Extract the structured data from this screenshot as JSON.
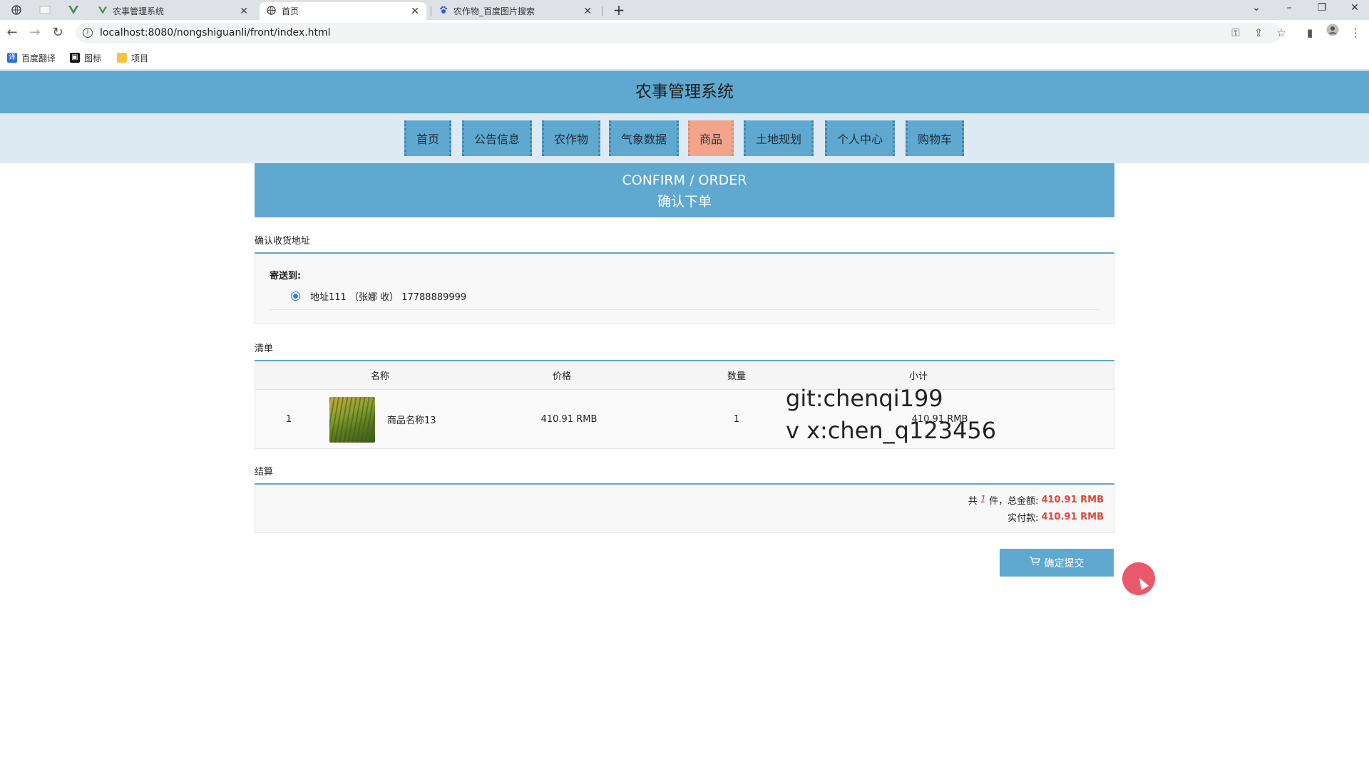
{
  "browser": {
    "tabs": [
      {
        "title": "农事管理系统",
        "active": false
      },
      {
        "title": "首页",
        "active": true
      },
      {
        "title": "农作物_百度图片搜索",
        "active": false
      }
    ],
    "url": "localhost:8080/nongshiguanli/front/index.html",
    "bookmarks": [
      "百度翻译",
      "图标",
      "项目"
    ]
  },
  "site": {
    "title": "农事管理系统",
    "nav": [
      "首页",
      "公告信息",
      "农作物",
      "气象数据",
      "商品",
      "土地规划",
      "个人中心",
      "购物车"
    ],
    "active_nav": "商品"
  },
  "banner": {
    "en": "CONFIRM / ORDER",
    "zh": "确认下单"
  },
  "address": {
    "section_title": "确认收货地址",
    "ship_label": "寄送到:",
    "entry": "地址111 （张娜 收） 17788889999"
  },
  "order": {
    "section_title": "清单",
    "headers": {
      "name": "名称",
      "price": "价格",
      "qty": "数量",
      "subtotal": "小计"
    },
    "rows": [
      {
        "index": "1",
        "name": "商品名称13",
        "price": "410.91 RMB",
        "qty": "1",
        "subtotal": "410.91 RMB"
      }
    ]
  },
  "settle": {
    "section_title": "结算",
    "count_prefix": "共",
    "count": "1",
    "count_suffix": "件，总金额:",
    "total": "410.91 RMB",
    "paid_label": "实付款:",
    "paid": "410.91 RMB"
  },
  "submit_label": "确定提交",
  "watermark": [
    "git:chenqi199",
    "v x:chen_q123456"
  ]
}
